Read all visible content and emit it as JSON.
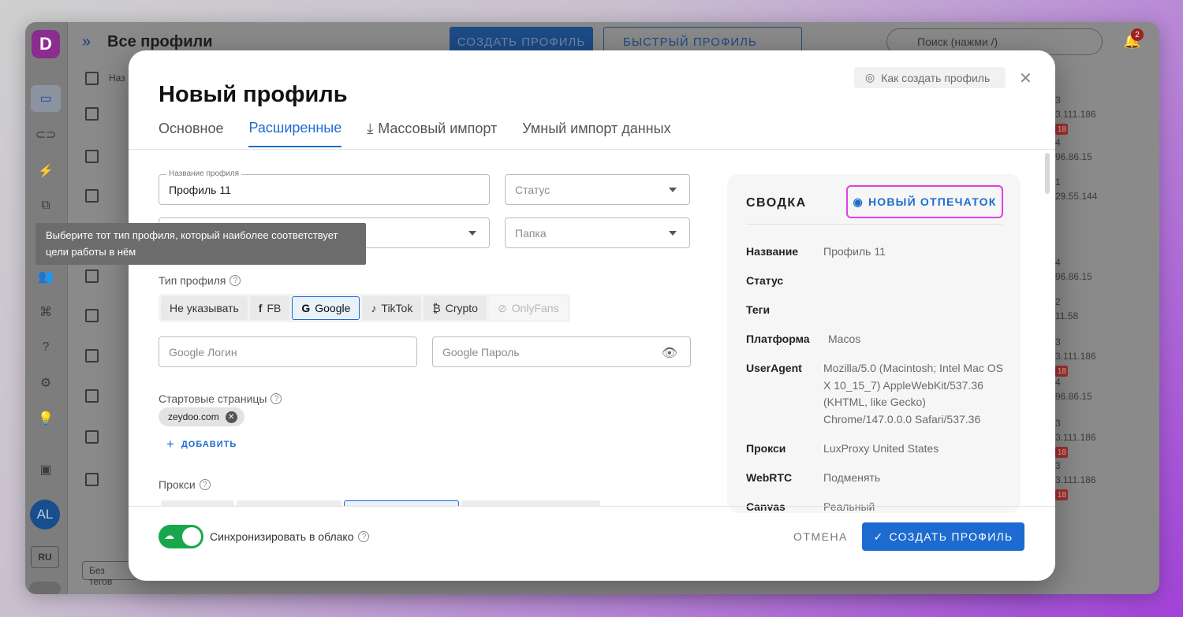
{
  "app": {
    "logo_letter": "D",
    "title": "Все профили",
    "create_button": "СОЗДАТЬ ПРОФИЛЬ",
    "quick_button": "БЫСТРЫЙ ПРОФИЛЬ",
    "search_placeholder": "Поиск (нажми /)",
    "notifications_count": "2",
    "avatar": "AL",
    "language": "RU",
    "table_header": "Наз",
    "footer_tags": "Без тегов",
    "background_rows": [
      {
        "text": "3",
        "text2": "3.111.186",
        "badge": "18"
      },
      {
        "text": "4",
        "text2": "96.86.15"
      },
      {
        "text": "1",
        "text2": "29.55.144"
      },
      {
        "text": "4",
        "text2": "96.86.15"
      },
      {
        "text": "2",
        "text2": "11.58"
      },
      {
        "text": "3",
        "text2": "3.111.186",
        "badge": "18"
      },
      {
        "text": "4",
        "text2": "96.86.15"
      },
      {
        "text": "3",
        "text2": "3.111.186",
        "badge": "18"
      },
      {
        "text": "3",
        "text2": "3.111.186",
        "badge": "18"
      }
    ]
  },
  "modal": {
    "title": "Новый профиль",
    "help_button": "Как создать профиль",
    "tabs": [
      {
        "label": "Основное"
      },
      {
        "label": "Расширенные"
      },
      {
        "label": "Массовый импорт"
      },
      {
        "label": "Умный импорт данных"
      }
    ],
    "profile_name": {
      "legend": "Название профиля",
      "value": "Профиль 11"
    },
    "status": {
      "placeholder": "Статус"
    },
    "folder": {
      "placeholder": "Папка"
    },
    "tooltip": "Выберите тот тип профиля, который наиболее соответствует цели работы в нём",
    "profile_type_label": "Тип профиля",
    "profile_types": [
      {
        "label": "Не указывать"
      },
      {
        "label": "FB"
      },
      {
        "label": "Google"
      },
      {
        "label": "TikTok"
      },
      {
        "label": "Crypto"
      },
      {
        "label": "OnlyFans"
      }
    ],
    "google_login": {
      "placeholder": "Google Логин"
    },
    "google_password": {
      "placeholder": "Google Пароль"
    },
    "start_pages_label": "Стартовые страницы",
    "start_page_tag": "zeydoo.com",
    "add_button": "ДОБАВИТЬ",
    "proxy_label": "Прокси",
    "sync_label": "Синхронизировать в облако",
    "cancel_button": "ОТМЕНА",
    "submit_button": "СОЗДАТЬ ПРОФИЛЬ"
  },
  "summary": {
    "title": "СВОДКА",
    "fingerprint_button": "НОВЫЙ ОТПЕЧАТОК",
    "rows": [
      {
        "key": "Название",
        "value": "Профиль 11"
      },
      {
        "key": "Статус",
        "value": ""
      },
      {
        "key": "Теги",
        "value": ""
      },
      {
        "key": "Платформа",
        "value": "Macos"
      },
      {
        "key": "UserAgent",
        "value": "Mozilla/5.0 (Macintosh; Intel Mac OS X 10_15_7) AppleWebKit/537.36 (KHTML, like Gecko) Chrome/147.0.0.0 Safari/537.36"
      },
      {
        "key": "Прокси",
        "value": "LuxProxy United States"
      },
      {
        "key": "WebRTC",
        "value": "Подменять"
      },
      {
        "key": "Canvas",
        "value": "Реальный"
      }
    ]
  },
  "colors": {
    "accent": "#1d6bd0",
    "sync_green": "#19a74b",
    "fingerprint_outline": "#e33ee6"
  }
}
